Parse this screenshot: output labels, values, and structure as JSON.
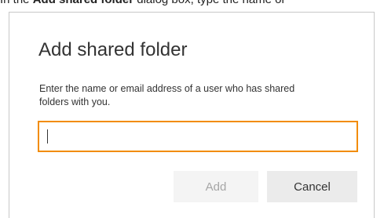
{
  "caption": {
    "prefix": "In the ",
    "bold": "Add shared folder",
    "suffix": " dialog box, type the name or"
  },
  "dialog": {
    "title": "Add shared folder",
    "instructions": "Enter the name or email address of a user who has shared folders with you.",
    "input": {
      "value": "",
      "placeholder": "",
      "focused": true
    },
    "buttons": {
      "add_label": "Add",
      "add_enabled": false,
      "cancel_label": "Cancel"
    }
  },
  "colors": {
    "focus_border": "#f28c00",
    "disabled_text": "#a6a6a6",
    "button_bg": "#ebebeb"
  }
}
